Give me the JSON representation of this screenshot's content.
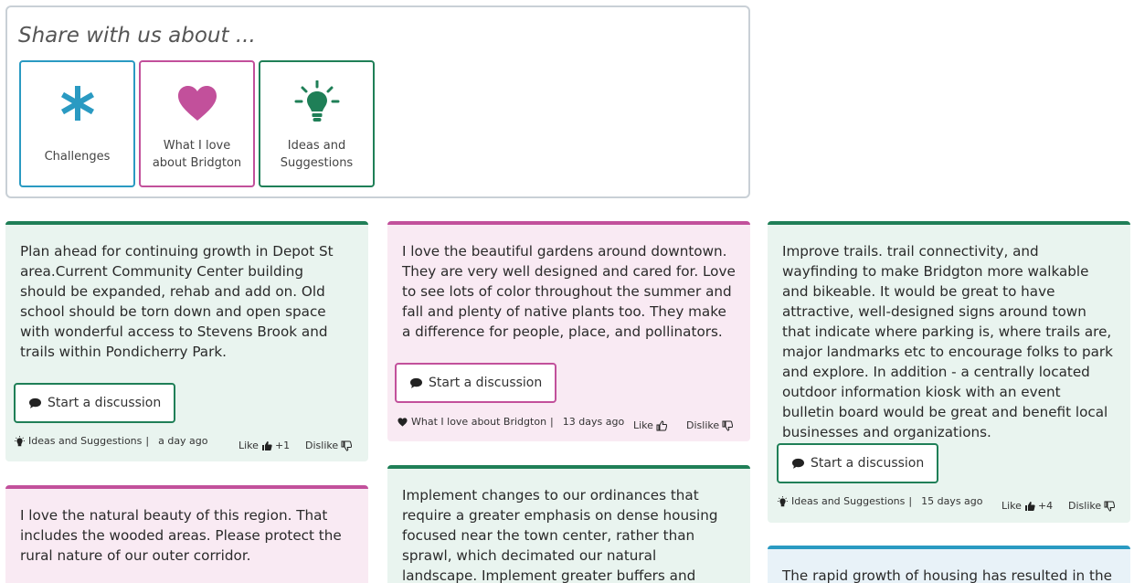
{
  "share": {
    "title": "Share with us about ...",
    "categories": [
      {
        "label": "Challenges",
        "icon": "asterisk-icon",
        "color": "#2a9ac2"
      },
      {
        "label": "What I love about Bridgton",
        "icon": "heart-icon",
        "color": "#c2509b"
      },
      {
        "label": "Ideas and Suggestions",
        "icon": "lightbulb-icon",
        "color": "#1f7f57"
      }
    ]
  },
  "cards": [
    {
      "text": "Plan ahead for continuing growth in Depot St area.Current Community Center building should be expanded, rehab and add on. Old school should be torn down and open space with wonderful access to Stevens Brook and trails within Pondicherry Park.",
      "button": "Start a discussion",
      "category": "Ideas and Suggestions",
      "time": "a day ago",
      "like": "Like",
      "like_count": "+1",
      "dislike": "Dislike"
    },
    {
      "text": "I love the beautiful gardens around downtown. They are very well designed and cared for. Love to see lots of color throughout the summer and fall and plenty of native plants too. They make a difference for people, place, and pollinators.",
      "button": "Start a discussion",
      "category": "What I love about Bridgton",
      "time": "13 days ago",
      "like": "Like",
      "like_count": "",
      "dislike": "Dislike"
    },
    {
      "text": "Improve trails. trail connectivity, and wayfinding to make Bridgton more walkable and bikeable. It would be great to have attractive, well-designed signs around town that indicate where parking is, where trails are, major landmarks etc to encourage folks to park and explore. In addition - a centrally located outdoor information kiosk with an event bulletin board would be great and benefit local businesses and organizations.",
      "button": "Start a discussion",
      "category": "Ideas and Suggestions",
      "time": "15 days ago",
      "like": "Like",
      "like_count": "+4",
      "dislike": "Dislike"
    },
    {
      "text": "I love the natural beauty of this region. That includes the wooded areas. Please protect the rural nature of our outer corridor."
    },
    {
      "text": "Implement changes to our ordinances that require a greater emphasis on dense housing focused near the town center, rather than sprawl, which decimated our natural landscape. Implement greater buffers and enlarge the"
    },
    {
      "text": "The rapid growth of housing has resulted in the"
    }
  ]
}
